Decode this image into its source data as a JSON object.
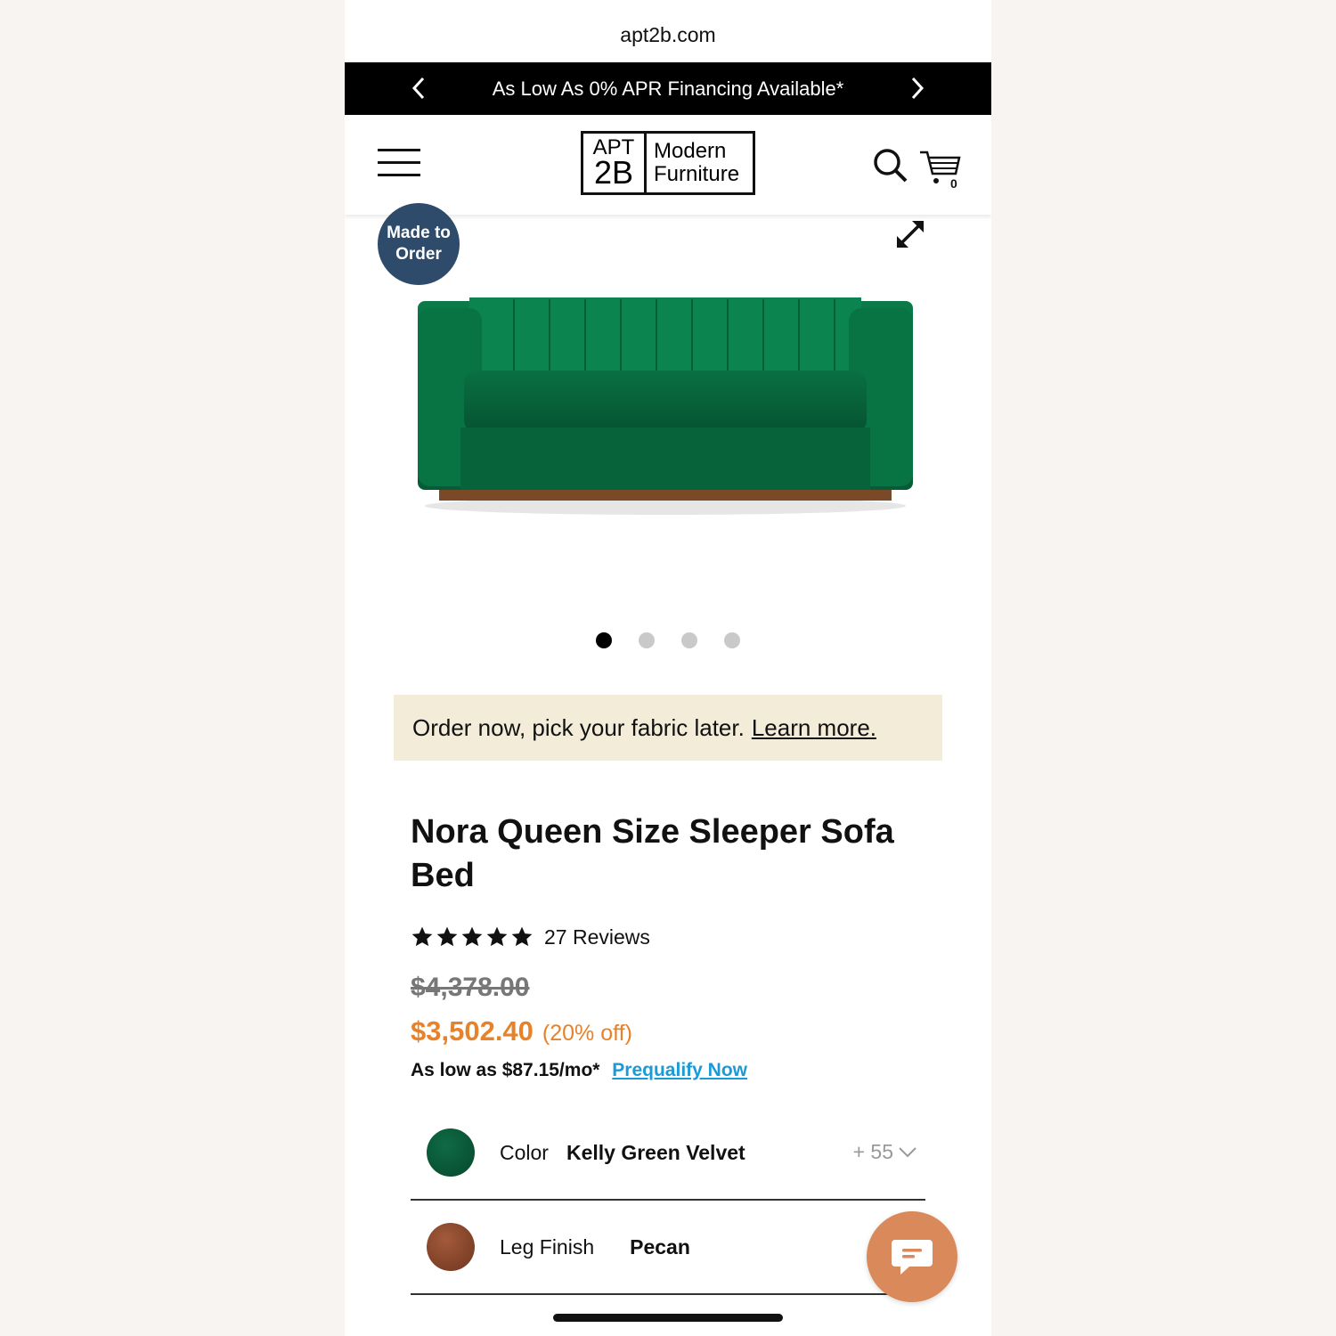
{
  "browser": {
    "url": "apt2b.com"
  },
  "promo": {
    "text": "As Low As 0% APR Financing Available*"
  },
  "header": {
    "logo_left_top": "APT",
    "logo_left_bottom": "2B",
    "logo_right_top": "Modern",
    "logo_right_bottom": "Furniture",
    "cart_count": "0"
  },
  "gallery": {
    "badge_line1": "Made to",
    "badge_line2": "Order",
    "dots_count": 4,
    "active_dot": 1
  },
  "notice": {
    "text": "Order now, pick your fabric later.",
    "link": "Learn more."
  },
  "product": {
    "title": "Nora Queen Size Sleeper Sofa Bed",
    "rating": 5,
    "reviews": "27 Reviews",
    "old_price": "$4,378.00",
    "price": "$3,502.40",
    "discount": "(20% off)",
    "finance_text": "As low as $87.15/mo*",
    "finance_link": "Prequalify Now"
  },
  "options": {
    "color_label": "Color",
    "color_value": "Kelly Green Velvet",
    "color_more": "+ 55",
    "leg_label": "Leg Finish",
    "leg_value": "Pecan"
  },
  "colors": {
    "accent_price": "#e8822a",
    "link": "#1a9ad6",
    "badge": "#2f4b6b",
    "notice_bg": "#f2ecd9",
    "chat": "#d9895a",
    "sofa": "#0a6b41"
  }
}
